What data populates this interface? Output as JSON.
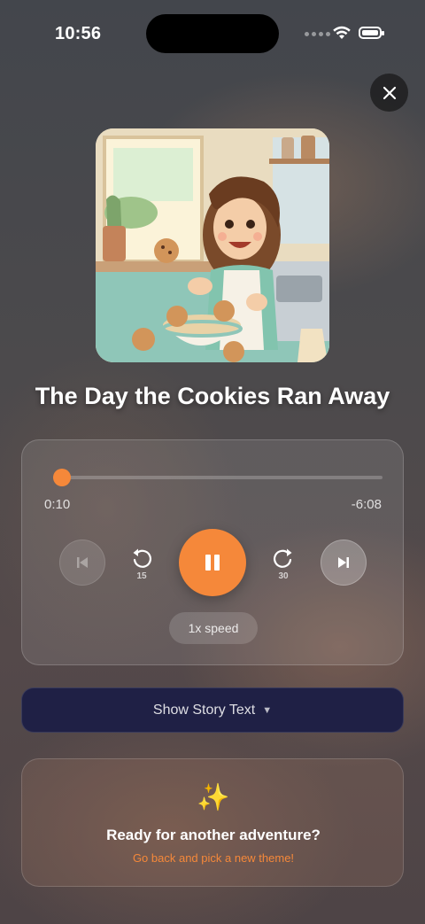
{
  "status_bar": {
    "time": "10:56"
  },
  "story": {
    "title": "The Day the Cookies Ran Away",
    "cover_image": "illustration of a smiling girl in a kitchen with dancing cookies around a mixing bowl"
  },
  "player": {
    "elapsed": "0:10",
    "remaining": "-6:08",
    "progress": 0.027,
    "state": "playing",
    "rewind_seconds": "15",
    "forward_seconds": "30",
    "speed_label": "1x speed"
  },
  "story_text_toggle": {
    "label": "Show Story Text",
    "arrow": "▼"
  },
  "adventure": {
    "icon": "sparkles-icon",
    "sparkle_glyph": "✨",
    "title": "Ready for another adventure?",
    "subtitle": "Go back and pick a new theme!"
  },
  "colors": {
    "accent": "#f5883a",
    "button_dark": "#1f2045"
  }
}
